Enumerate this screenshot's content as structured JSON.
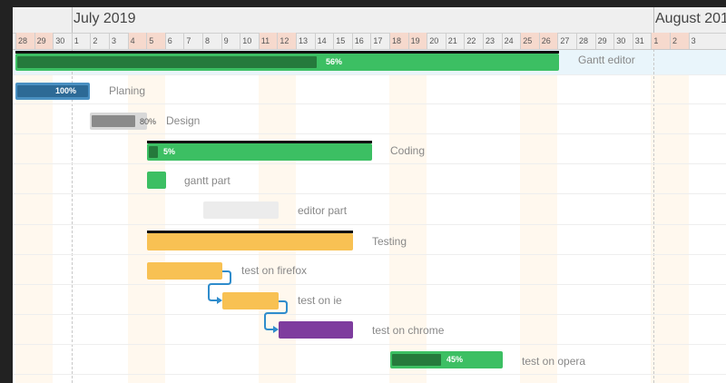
{
  "timeline": {
    "months": [
      {
        "label": "July 2019"
      },
      {
        "label": "August 201"
      }
    ],
    "days": [
      "28",
      "29",
      "30",
      "1",
      "2",
      "3",
      "4",
      "5",
      "6",
      "7",
      "8",
      "9",
      "10",
      "11",
      "12",
      "13",
      "14",
      "15",
      "16",
      "17",
      "18",
      "19",
      "20",
      "21",
      "22",
      "23",
      "24",
      "25",
      "26",
      "27",
      "28",
      "29",
      "30",
      "31",
      "1",
      "2",
      "3"
    ],
    "weekend_days": [
      0,
      1,
      6,
      7,
      13,
      14,
      20,
      21,
      27,
      28,
      34,
      35
    ]
  },
  "colors": {
    "green": "#3cbf63",
    "green_dark": "#257a3c",
    "blue": "#4a90c2",
    "blue_dark": "#2d6a96",
    "gray_bar": "#d8d8d8",
    "gray_fill": "#8a8a8a",
    "light_gray": "#ececec",
    "yellow": "#f8c153",
    "purple": "#7e3c9e",
    "link": "#2f8ccc"
  },
  "tasks": [
    {
      "name": "Gantt editor",
      "progress_label": "56%",
      "progress": 0.56,
      "summary": true
    },
    {
      "name": "Planing",
      "progress_label": "100%",
      "progress": 1.0
    },
    {
      "name": "Design",
      "progress_label": "80%",
      "progress": 0.8
    },
    {
      "name": "Coding",
      "progress_label": "5%",
      "progress": 0.05
    },
    {
      "name": "gantt part"
    },
    {
      "name": "editor part"
    },
    {
      "name": "Testing"
    },
    {
      "name": "test on firefox"
    },
    {
      "name": "test on ie"
    },
    {
      "name": "test on chrome"
    },
    {
      "name": "test on opera",
      "progress_label": "45%",
      "progress": 0.45
    }
  ]
}
